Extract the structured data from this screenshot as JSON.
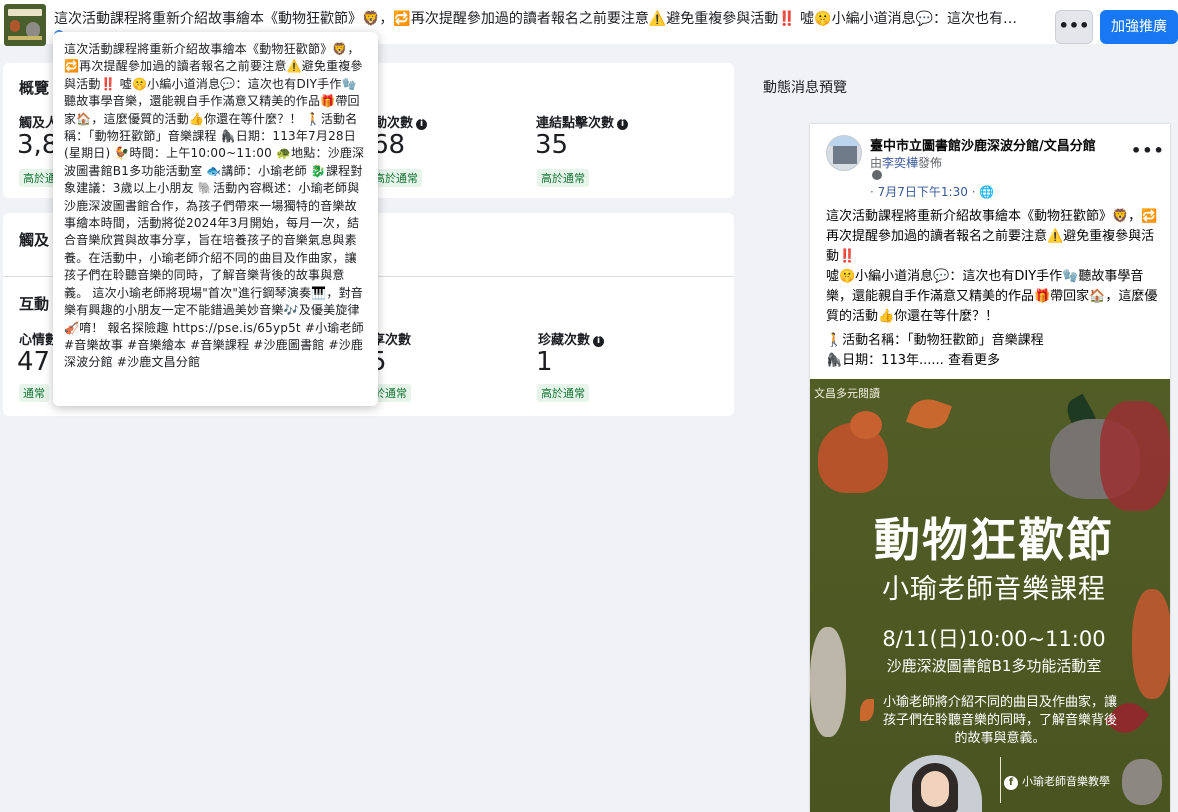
{
  "header": {
    "title": "這次活動課程將重新介紹故事繪本《動物狂歡節》🦁，🔁再次提醒參加過的讀者報名之前要注意⚠️避免重複參與活動‼️ 噓🤫小編小道消息💬：這次也有…",
    "more_label": "•••",
    "boost_label": "加強推廣"
  },
  "overview": {
    "title": "概覽",
    "metrics": [
      {
        "label": "觸及人",
        "value": "3,8",
        "badge": "高於通"
      },
      {
        "label": "動次數",
        "value": "68",
        "badge": "高於通常"
      },
      {
        "label": "連結點擊次數",
        "value": "35",
        "badge": "高於通常"
      }
    ]
  },
  "engagement": {
    "section1_title": "觸及",
    "section2_title": "互動",
    "metrics": [
      {
        "label": "心情數",
        "value": "47",
        "badge": "通常"
      },
      {
        "label": "享次數",
        "value": "5",
        "badge": "於通常"
      },
      {
        "label": "珍藏次數",
        "value": "1",
        "badge": "高於通常"
      }
    ]
  },
  "tooltip": {
    "text": "這次活動課程將重新介紹故事繪本《動物狂歡節》🦁，🔁再次提醒參加過的讀者報名之前要注意⚠️避免重複參與活動‼️ 噓🤫小編小道消息💬：這次也有DIY手作🧤聽故事學音樂，還能親自手作滿意又精美的作品🎁帶回家🏠，這麼優質的活動👍你還在等什麼？！ 🚶活動名稱：「動物狂歡節」音樂課程 🦍日期：113年7月28日 (星期日) 🐓時間：上午10:00~11:00 🐢地點：沙鹿深波圖書館B1多功能活動室 🐟講師：小瑜老師 🐉課程對象建議：3歲以上小朋友 🐘活動內容概述：小瑜老師與沙鹿深波圖書館合作，為孩子們帶來一場獨特的音樂故事繪本時間，活動將從2024年3月開始，每月一次，結合音樂欣賞與故事分享，旨在培養孩子的音樂氣息與素養。在活動中，小瑜老師介紹不同的曲目及作曲家，讓孩子們在聆聽音樂的同時，了解音樂背後的故事與意義。 這次小瑜老師將現場\"首次\"進行鋼琴演奏🎹，對音樂有興趣的小朋友一定不能錯過美妙音樂🎶及優美旋律🎻唷！ 報名探險趣 https://pse.is/65yp5t #小瑜老師 #音樂故事 #音樂繪本 #音樂課程 #沙鹿圖書館 #沙鹿深波分館 #沙鹿文昌分館"
  },
  "preview": {
    "title": "動態消息預覽",
    "page_name": "臺中市立圖書館沙鹿深波分館/文昌分館",
    "posted_by_prefix": "由",
    "posted_by_name": "李奕樺",
    "posted_by_suffix": "發佈",
    "time": "7月7日下午1:30",
    "time_suffix": "· 🌐",
    "more_label": "•••",
    "para1": "這次活動課程將重新介紹故事繪本《動物狂歡節》🦁，🔁再次提醒參加過的讀者報名之前要注意⚠️避免重複參與活動‼️",
    "para2": "噓🤫小編小道消息💬：這次也有DIY手作🧤聽故事學音樂，還能親自手作滿意又精美的作品🎁帶回家🏠，這麼優質的活動👍你還在等什麼？！",
    "para3_line1": "🚶活動名稱：「動物狂歡節」音樂課程",
    "para3_line2": "🦍日期：113年......",
    "see_more": "查看更多"
  },
  "poster": {
    "corner": "文昌多元閱讀",
    "headline": "動物狂歡節",
    "subtitle": "小瑜老師音樂課程",
    "date": "8/11(日)10:00~11:00",
    "venue": "沙鹿深波圖書館B1多功能活動室",
    "description": "小瑜老師將介紹不同的曲目及作曲家，讓孩子們在聆聽音樂的同時，了解音樂背後的故事與意義。",
    "fb_label": "小瑜老師音樂教學",
    "fb_icon": "f"
  },
  "colors": {
    "accent": "#1877f2",
    "poster_bg": "#4f5a24",
    "badge_green": "#137333"
  }
}
